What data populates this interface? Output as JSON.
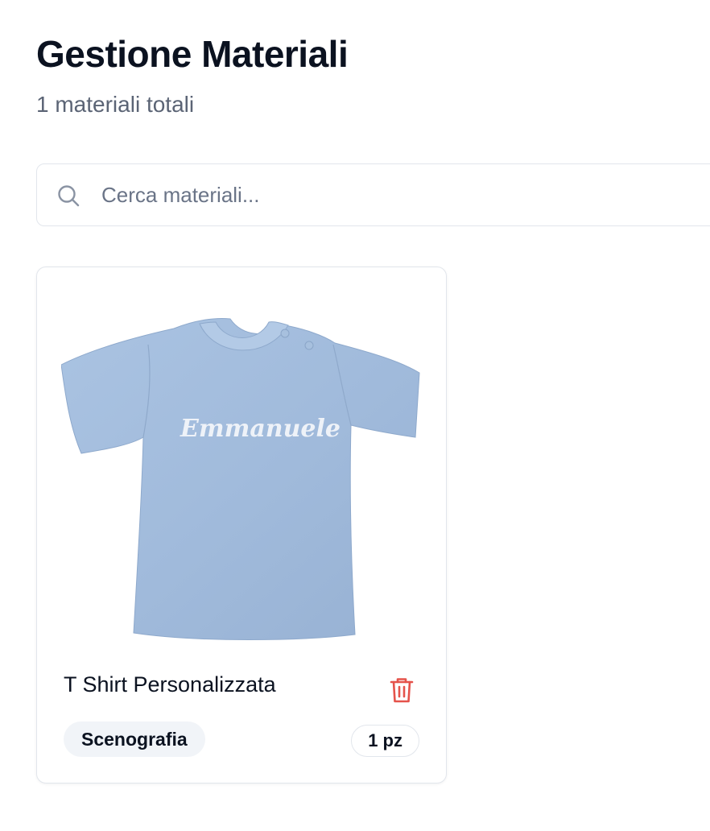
{
  "header": {
    "title": "Gestione Materiali",
    "subtitle": "1 materiali totali"
  },
  "search": {
    "icon": "search-icon",
    "placeholder": "Cerca materiali...",
    "value": ""
  },
  "materials": [
    {
      "image": {
        "description_icon": "t-shirt-image",
        "print_text": "Emmanuele",
        "shirt_color": "#a3bede"
      },
      "name": "T Shirt Personalizzata",
      "category": "Scenografia",
      "quantity": "1 pz",
      "delete_icon": "trash-icon",
      "delete_color": "#e5534b"
    }
  ],
  "colors": {
    "text": "#0b1220",
    "muted": "#5b6475",
    "border": "#e2e6ec",
    "badge_bg": "#f1f4f8"
  }
}
